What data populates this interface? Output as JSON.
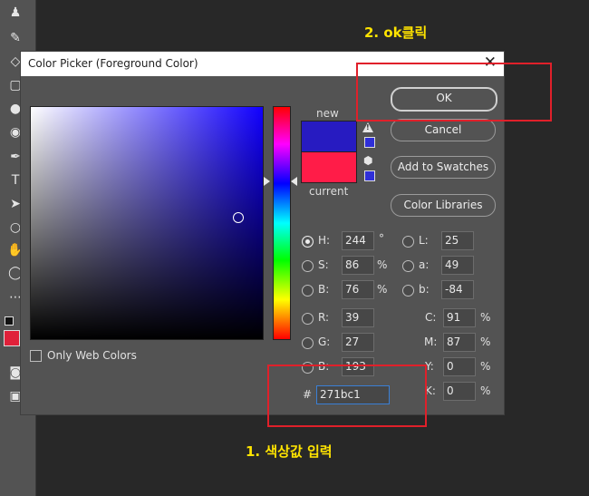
{
  "dialog": {
    "title": "Color Picker (Foreground Color)",
    "close_glyph": "✕"
  },
  "preview": {
    "new_label": "new",
    "current_label": "current",
    "new_color": "#271bc1",
    "current_color": "#ff1c48"
  },
  "buttons": {
    "ok": "OK",
    "cancel": "Cancel",
    "add_to_swatches": "Add to Swatches",
    "color_libraries": "Color Libraries"
  },
  "fields": {
    "H": {
      "label": "H:",
      "value": "244",
      "unit": "°"
    },
    "S": {
      "label": "S:",
      "value": "86",
      "unit": "%"
    },
    "B": {
      "label": "B:",
      "value": "76",
      "unit": "%"
    },
    "R": {
      "label": "R:",
      "value": "39"
    },
    "G": {
      "label": "G:",
      "value": "27"
    },
    "Bl": {
      "label": "B:",
      "value": "193"
    },
    "L": {
      "label": "L:",
      "value": "25"
    },
    "a": {
      "label": "a:",
      "value": "49"
    },
    "b": {
      "label": "b:",
      "value": "-84"
    },
    "C": {
      "label": "C:",
      "value": "91",
      "unit": "%"
    },
    "M": {
      "label": "M:",
      "value": "87",
      "unit": "%"
    },
    "Y": {
      "label": "Y:",
      "value": "0",
      "unit": "%"
    },
    "K": {
      "label": "K:",
      "value": "0",
      "unit": "%"
    },
    "hex_label": "#",
    "hex": "271bc1"
  },
  "only_web_colors": "Only Web Colors",
  "annotations": {
    "step1": "1. 색상값 입력",
    "step2": "2. ok클릭"
  },
  "colors": {
    "annotation_text": "#ffe400",
    "annotation_box": "#e0202a",
    "foreground_swatch": "#e0213a"
  },
  "icons": [
    "gamut-warning-icon",
    "web-safe-cube-icon"
  ],
  "toolbar": {
    "tools": [
      "stamp-icon",
      "history-brush-icon",
      "eraser-icon",
      "gradient-icon",
      "blur-icon",
      "dodge-icon",
      "pen-icon",
      "type-icon",
      "path-select-icon",
      "shape-icon",
      "hand-icon",
      "zoom-icon",
      "more-icon",
      "default-colors-icon",
      "quick-mask-icon",
      "screen-mode-icon"
    ]
  }
}
